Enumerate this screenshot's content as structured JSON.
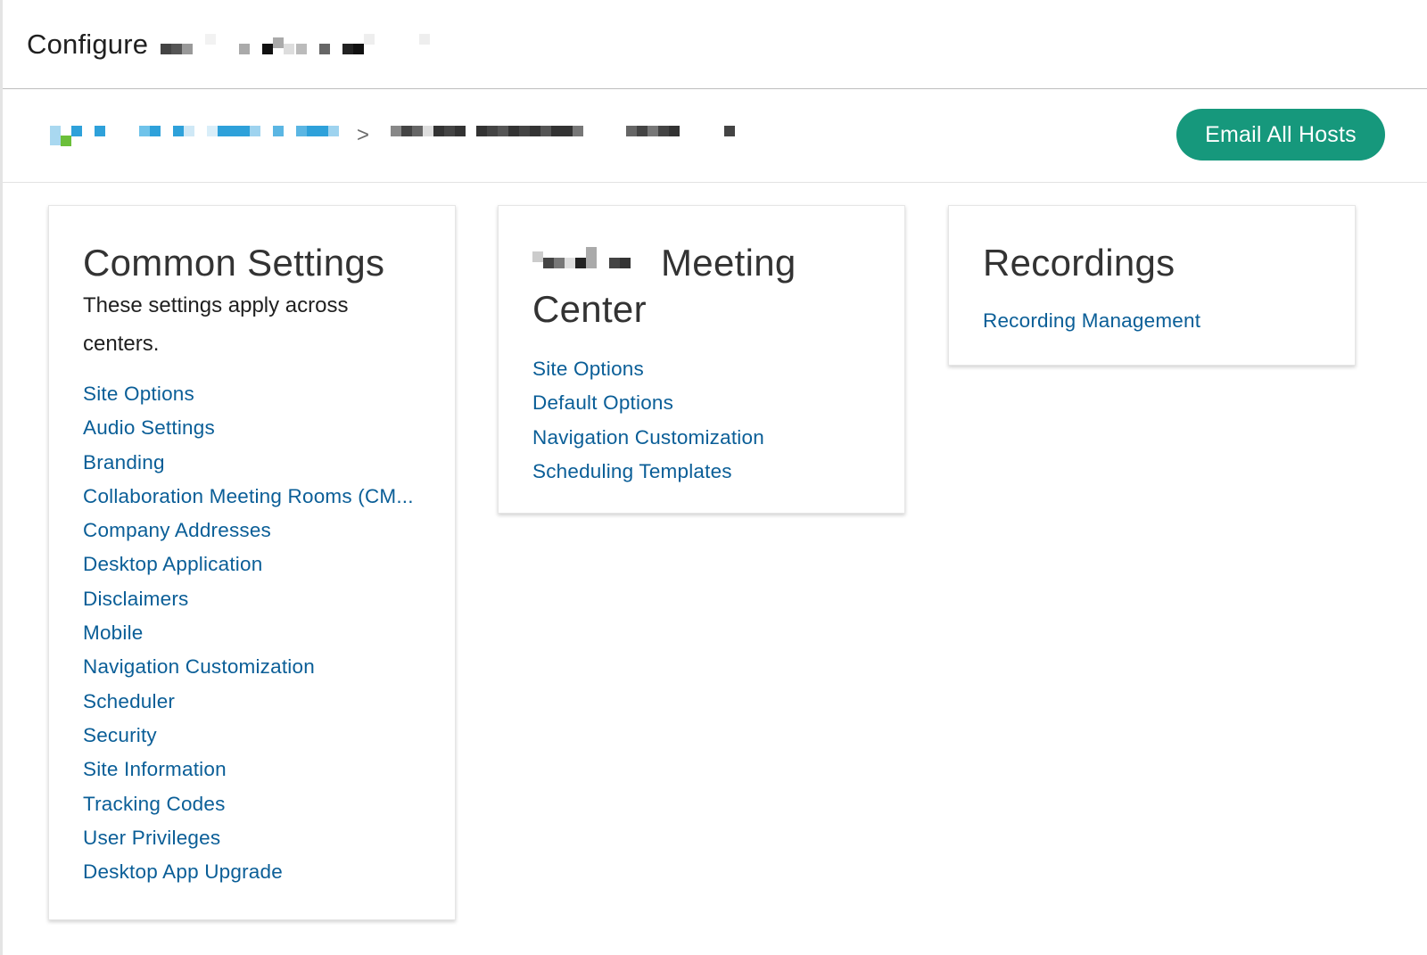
{
  "header": {
    "title": "Configure"
  },
  "breadcrumb": {
    "separator": ">"
  },
  "actions": {
    "email_all_hosts": "Email All Hosts"
  },
  "common_settings": {
    "title": "Common Settings",
    "description": "These settings apply across centers.",
    "links": [
      "Site Options",
      "Audio Settings",
      "Branding",
      "Collaboration Meeting Rooms (CM...",
      "Company Addresses",
      "Desktop Application",
      "Disclaimers",
      "Mobile",
      "Navigation Customization",
      "Scheduler",
      "Security",
      "Site Information",
      "Tracking Codes",
      "User Privileges",
      "Desktop App Upgrade"
    ]
  },
  "meeting_center": {
    "title_part1": "Meeting",
    "title_part2": "Center",
    "links": [
      "Site Options",
      "Default Options",
      "Navigation Customization",
      "Scheduling Templates"
    ]
  },
  "recordings": {
    "title": "Recordings",
    "links": [
      "Recording Management"
    ]
  },
  "colors": {
    "accent_button": "#16987c",
    "link": "#0a5e97",
    "text": "#1f1f1f"
  }
}
